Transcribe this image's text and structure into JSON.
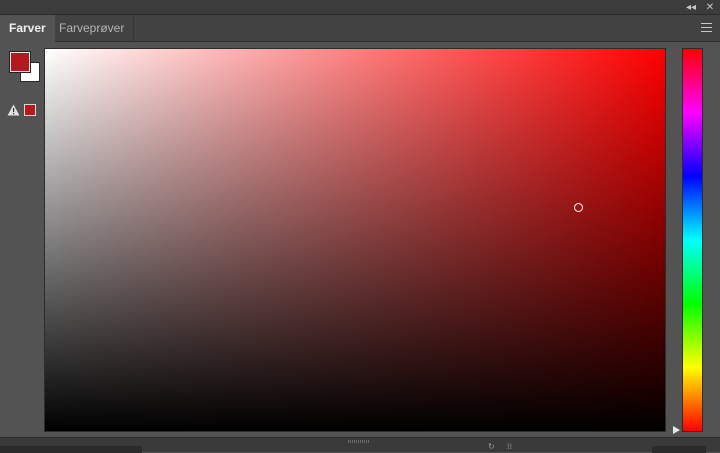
{
  "window": {
    "collapse_label": "◂◂",
    "close_label": "✕"
  },
  "tabs": [
    {
      "label": "Farver",
      "active": true
    },
    {
      "label": "Farveprøver",
      "active": false
    }
  ],
  "panel_menu_icon": "hamburger-menu-icon",
  "colors": {
    "foreground": "#b5181d",
    "background": "#ffffff",
    "gamut_warning_swatch": "#b5181d",
    "selected_hue": "#ff0000"
  },
  "icons": {
    "gamut_warning": "warning-triangle-icon",
    "hue_marker": "triangle-pointer-icon"
  }
}
